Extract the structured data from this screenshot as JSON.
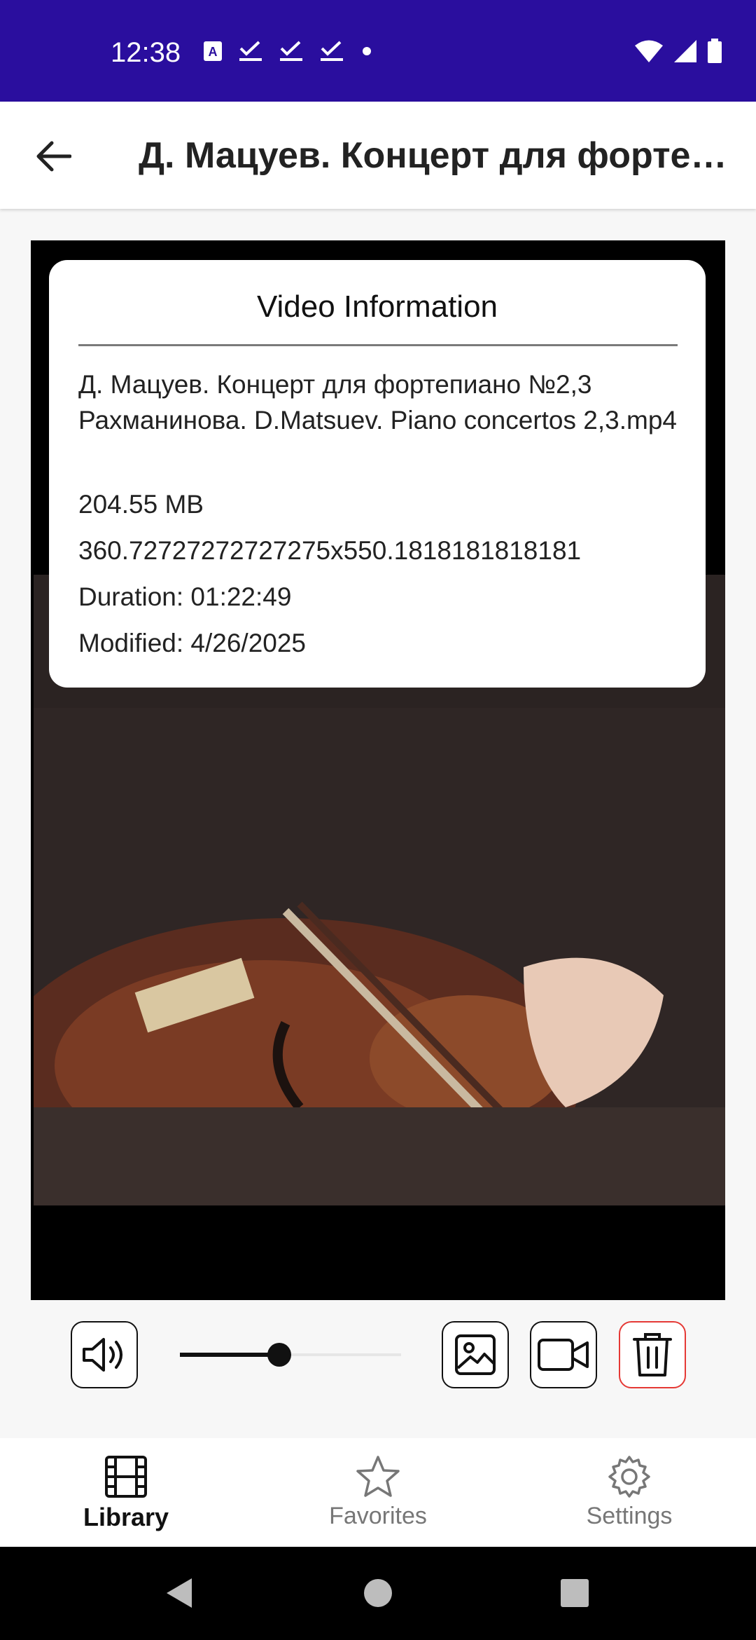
{
  "status_bar": {
    "time": "12:38",
    "icons_left": [
      "translate-icon",
      "check-icon",
      "check-icon",
      "check-icon",
      "dot-icon"
    ],
    "icons_right": [
      "wifi-icon",
      "signal-icon",
      "battery-icon"
    ]
  },
  "app_bar": {
    "back_icon": "arrow-left-icon",
    "title": "Д. Мацуев. Концерт для фортепиано №2,3 Рахманинова. D.Matsuev. Piano concertos 2,3.mp4"
  },
  "info_dialog": {
    "title": "Video Information",
    "file_name": "Д. Мацуев. Концерт для фортепиано №2,3 Рахманинова. D.Matsuev. Piano concertos 2,3.mp4",
    "size": "204.55 MB",
    "resolution": "360.72727272727275x550.1818181818181",
    "duration": "Duration: 01:22:49",
    "modified": "Modified: 4/26/2025"
  },
  "controls": {
    "volume_icon": "speaker-icon",
    "volume_level": 0.45,
    "buttons": [
      "image-icon",
      "video-camera-icon",
      "trash-icon"
    ],
    "delete_color": "#e53935"
  },
  "bottom_nav": {
    "items": [
      {
        "label": "Library",
        "icon": "film-icon",
        "active": true
      },
      {
        "label": "Favorites",
        "icon": "star-icon",
        "active": false
      },
      {
        "label": "Settings",
        "icon": "gear-icon",
        "active": false
      }
    ]
  },
  "colors": {
    "status_bar": "#2a0e9e",
    "accent_delete": "#e53935"
  }
}
